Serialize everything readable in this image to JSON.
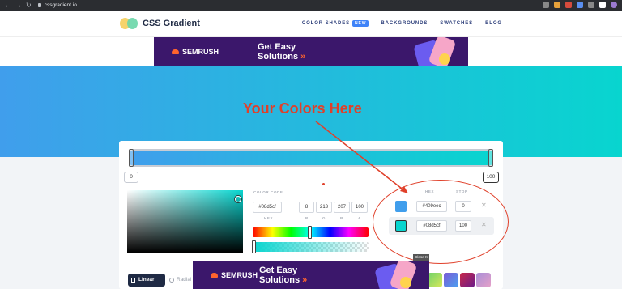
{
  "browser": {
    "url": "cssgradient.io",
    "nav_glyphs": [
      "←",
      "→",
      "↻"
    ]
  },
  "site": {
    "name": "CSS Gradient",
    "nav": [
      "COLOR SHADES",
      "BACKGROUNDS",
      "SWATCHES",
      "BLOG"
    ],
    "new_badge": "NEW"
  },
  "ads": {
    "brand": "SEMRUSH",
    "headline_line1": "Get Easy",
    "headline_line2": "Solutions",
    "close_label": "Close X"
  },
  "annotation": {
    "text": "Your Colors Here",
    "color": "#e0402a"
  },
  "gradient": {
    "start_color": "#409eec",
    "end_color": "#08d5cf",
    "start_position": "0",
    "end_position": "100"
  },
  "picker": {
    "color_code_label": "COLOR CODE",
    "hex_value": "#08d5cf",
    "hex_label": "HEX",
    "r": "8",
    "g": "213",
    "b": "207",
    "a": "100",
    "r_label": "R",
    "g_label": "G",
    "b_label": "B",
    "a_label": "A"
  },
  "stops": {
    "hex_header": "HEX",
    "stop_header": "STOP",
    "rows": [
      {
        "hex": "#409eec",
        "position": "0",
        "color": "#409eec"
      },
      {
        "hex": "#08d5cf",
        "position": "100",
        "color": "#08d5cf"
      }
    ],
    "delete_glyph": "✕"
  },
  "toolbar": {
    "linear": "Linear",
    "radial": "Radial"
  },
  "presets": [
    "#6fd26a",
    "#7a5cd6",
    "#c8284a",
    "#a98fd8"
  ]
}
